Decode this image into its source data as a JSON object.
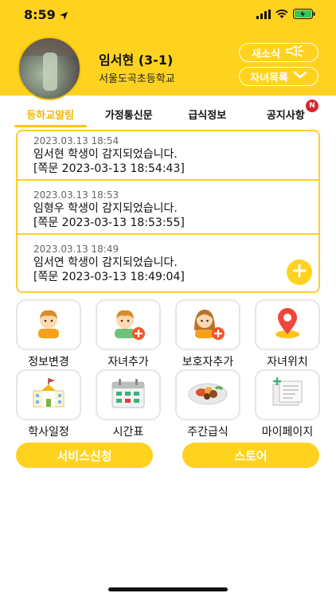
{
  "status_bar": {
    "time": "8:59"
  },
  "header": {
    "student": "임서현 (3-1)",
    "school": "서울도곡초등학교",
    "news_button": "새소식",
    "children_button": "자녀목록"
  },
  "tabs": [
    {
      "label": "등하교알림",
      "active": true
    },
    {
      "label": "가정통신문",
      "active": false
    },
    {
      "label": "급식정보",
      "active": false
    },
    {
      "label": "공지사항",
      "active": false,
      "badge": "N"
    }
  ],
  "alerts": [
    {
      "time": "2023.03.13 18:54",
      "message": "임서현 학생이 감지되었습니다.",
      "stamp": "[쪽문 2023-03-13 18:54:43]"
    },
    {
      "time": "2023.03.13 18:53",
      "message": "임형우 학생이 감지되었습니다.",
      "stamp": "[쪽문 2023-03-13 18:53:55]"
    },
    {
      "time": "2023.03.13 18:49",
      "message": "임서연 학생이 감지되었습니다.",
      "stamp": "[쪽문 2023-03-13 18:49:04]"
    }
  ],
  "menu": [
    {
      "label": "정보변경",
      "icon": "boy-icon"
    },
    {
      "label": "자녀추가",
      "icon": "boy-add-icon"
    },
    {
      "label": "보호자추가",
      "icon": "girl-add-icon"
    },
    {
      "label": "자녀위치",
      "icon": "location-pin-icon"
    },
    {
      "label": "학사일정",
      "icon": "school-icon"
    },
    {
      "label": "시간표",
      "icon": "calendar-icon"
    },
    {
      "label": "주간급식",
      "icon": "meal-icon"
    },
    {
      "label": "마이페이지",
      "icon": "document-icon"
    }
  ],
  "buttons": {
    "service": "서비스신청",
    "store": "스토어"
  },
  "colors": {
    "brand_yellow": "#ffd21f",
    "badge_red": "#d9262c",
    "active_tab_text": "#f2b900"
  }
}
